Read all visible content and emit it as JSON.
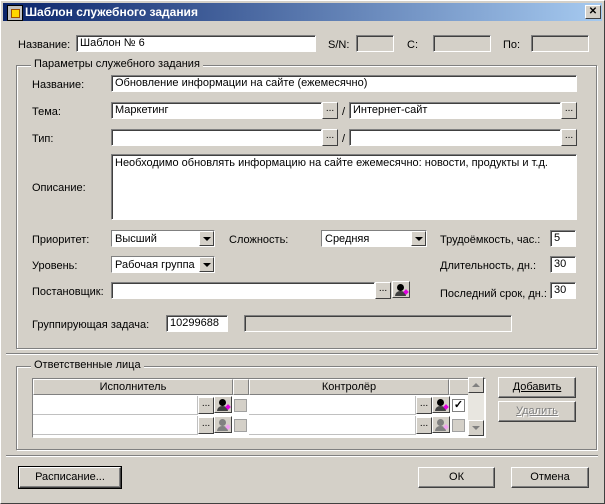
{
  "window": {
    "title": "Шаблон служебного задания",
    "close_glyph": "✕"
  },
  "header": {
    "name_label": "Название:",
    "name_value": "Шаблон № 6",
    "sn_label": "S/N:",
    "c_label": "С:",
    "po_label": "По:"
  },
  "params": {
    "group_title": "Параметры служебного задания",
    "name_label": "Название:",
    "name_value": "Обновление информации на сайте (ежемесячно)",
    "topic_label": "Тема:",
    "topic_value": "Маркетинг",
    "topic2_value": "Интернет-сайт",
    "type_label": "Тип:",
    "type_value": "",
    "type2_value": "",
    "slash": "/",
    "ellipsis": "...",
    "desc_label": "Описание:",
    "desc_value": "Необходимо обновлять информацию на сайте ежемесячно: новости, продукты и т.д.",
    "priority_label": "Приоритет:",
    "priority_value": "Высший",
    "complexity_label": "Сложность:",
    "complexity_value": "Средняя",
    "labor_label": "Трудоёмкость, час.:",
    "labor_value": "5",
    "level_label": "Уровень:",
    "level_value": "Рабочая группа",
    "duration_label": "Длительность, дн.:",
    "duration_value": "30",
    "setter_label": "Постановщик:",
    "setter_value": "",
    "deadline_label": "Последний срок, дн.:",
    "deadline_value": "30",
    "group_task_label": "Группирующая задача:",
    "group_task_value": "10299688",
    "group_task_desc": ""
  },
  "responsible": {
    "group_title": "Ответственные лица",
    "col_executor": "Исполнитель",
    "col_controller": "Контролёр",
    "rows": [
      {
        "executor": "",
        "controller": "",
        "controller_checked": "✓"
      },
      {
        "executor": "",
        "controller": "",
        "controller_checked": ""
      }
    ],
    "add_label": "Добавить",
    "delete_label": "Удалить"
  },
  "footer": {
    "schedule_label": "Расписание...",
    "ok_label": "ОК",
    "cancel_label": "Отмена"
  }
}
